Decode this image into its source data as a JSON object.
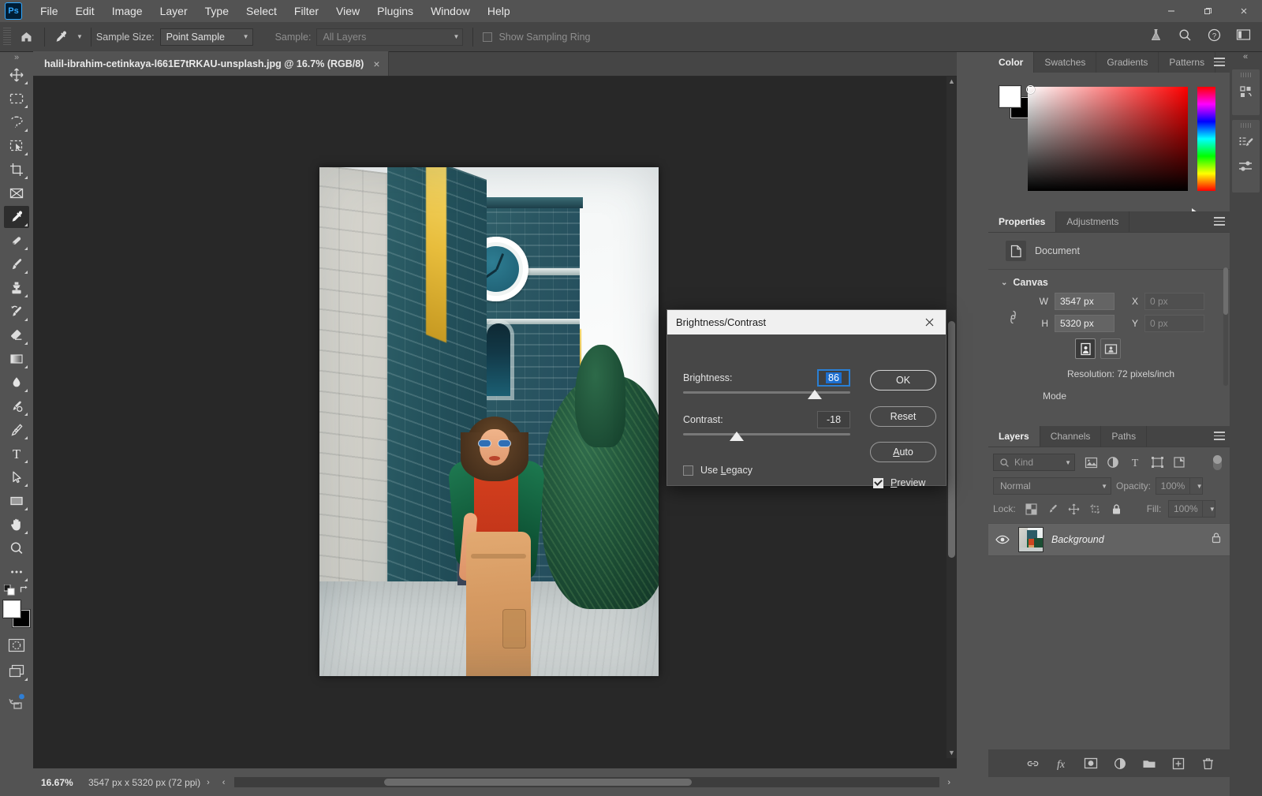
{
  "app": {
    "logo": "Ps",
    "menus": [
      "File",
      "Edit",
      "Image",
      "Layer",
      "Type",
      "Select",
      "Filter",
      "View",
      "Plugins",
      "Window",
      "Help"
    ],
    "window_controls": {
      "minimize": "minimize-icon",
      "restore": "restore-icon",
      "close": "close-icon"
    }
  },
  "options_bar": {
    "home_icon": "home-icon",
    "tool_icon": "eyedropper-icon",
    "sample_size_label": "Sample Size:",
    "sample_size_value": "Point Sample",
    "sample_label": "Sample:",
    "sample_value": "All Layers",
    "show_sampling_ring_label": "Show Sampling Ring",
    "show_sampling_ring_checked": false,
    "right_icons": [
      "flask-icon",
      "search-icon",
      "help-icon",
      "workspace-icon"
    ]
  },
  "toolbar": {
    "tools": [
      {
        "name": "move-tool",
        "icon": "move-icon",
        "has_flyout": true,
        "active": false
      },
      {
        "name": "marquee-tool",
        "icon": "rectangular-marquee-icon",
        "has_flyout": true,
        "active": false
      },
      {
        "name": "lasso-tool",
        "icon": "lasso-icon",
        "has_flyout": true,
        "active": false
      },
      {
        "name": "object-selection-tool",
        "icon": "object-selection-icon",
        "has_flyout": true,
        "active": false
      },
      {
        "name": "crop-tool",
        "icon": "crop-icon",
        "has_flyout": true,
        "active": false
      },
      {
        "name": "frame-tool",
        "icon": "frame-icon",
        "has_flyout": false,
        "active": false
      },
      {
        "name": "eyedropper-tool",
        "icon": "eyedropper-icon",
        "has_flyout": true,
        "active": true
      },
      {
        "name": "spot-healing-tool",
        "icon": "spot-healing-icon",
        "has_flyout": true,
        "active": false
      },
      {
        "name": "brush-tool",
        "icon": "brush-icon",
        "has_flyout": true,
        "active": false
      },
      {
        "name": "clone-stamp-tool",
        "icon": "clone-stamp-icon",
        "has_flyout": true,
        "active": false
      },
      {
        "name": "history-brush-tool",
        "icon": "history-brush-icon",
        "has_flyout": true,
        "active": false
      },
      {
        "name": "eraser-tool",
        "icon": "eraser-icon",
        "has_flyout": true,
        "active": false
      },
      {
        "name": "gradient-tool",
        "icon": "gradient-icon",
        "has_flyout": true,
        "active": false
      },
      {
        "name": "blur-tool",
        "icon": "blur-drop-icon",
        "has_flyout": true,
        "active": false
      },
      {
        "name": "dodge-tool",
        "icon": "dodge-icon",
        "has_flyout": true,
        "active": false
      },
      {
        "name": "pen-tool",
        "icon": "pen-icon",
        "has_flyout": true,
        "active": false
      },
      {
        "name": "type-tool",
        "icon": "type-t-icon",
        "has_flyout": true,
        "active": false
      },
      {
        "name": "path-selection-tool",
        "icon": "path-arrow-icon",
        "has_flyout": true,
        "active": false
      },
      {
        "name": "rectangle-tool",
        "icon": "rectangle-icon",
        "has_flyout": true,
        "active": false
      },
      {
        "name": "hand-tool",
        "icon": "hand-icon",
        "has_flyout": true,
        "active": false
      },
      {
        "name": "zoom-tool",
        "icon": "magnifier-icon",
        "has_flyout": false,
        "active": false
      },
      {
        "name": "edit-toolbar",
        "icon": "ellipsis-icon",
        "has_flyout": true,
        "active": false
      }
    ],
    "foreground_color": "#ffffff",
    "background_color": "#000000",
    "quick_mask_icon": "quick-mask-icon",
    "screen_mode_icon": "screen-mode-icon",
    "cloud_icon": "sync-cloud-icon"
  },
  "document": {
    "tab_title": "halil-ibrahim-cetinkaya-l661E7tRKAU-unsplash.jpg @ 16.7% (RGB/8)",
    "close_icon": "close-icon"
  },
  "status_bar": {
    "zoom": "16.67%",
    "dimensions": "3547 px x 5320 px (72 ppi)",
    "arrow": "›",
    "left_arrow": "‹"
  },
  "right_rail": {
    "collapse_icon": "collapse-chevrons-icon",
    "buttons": [
      "libraries-icon",
      "brush-settings-icon",
      "adjustments-sliders-icon"
    ]
  },
  "color_panel": {
    "tabs": [
      "Color",
      "Swatches",
      "Gradients",
      "Patterns"
    ],
    "active_tab": "Color",
    "menu_icon": "panel-menu-icon",
    "foreground": "#ffffff",
    "background": "#000000"
  },
  "properties_panel": {
    "tabs": [
      "Properties",
      "Adjustments"
    ],
    "active_tab": "Properties",
    "menu_icon": "panel-menu-icon",
    "doc_icon": "document-icon",
    "doc_label": "Document",
    "section_title": "Canvas",
    "twisty": "⌄",
    "link_icon": "link-chain-icon",
    "fields": [
      {
        "key": "W",
        "value": "3547 px",
        "empty": false
      },
      {
        "key": "X",
        "value": "0 px",
        "empty": true
      },
      {
        "key": "H",
        "value": "5320 px",
        "empty": false
      },
      {
        "key": "Y",
        "value": "0 px",
        "empty": true
      }
    ],
    "orientation": [
      {
        "name": "portrait-orientation",
        "icon": "portrait-icon",
        "active": true
      },
      {
        "name": "landscape-orientation",
        "icon": "landscape-icon",
        "active": false
      }
    ],
    "resolution": "Resolution: 72 pixels/inch",
    "mode_label": "Mode"
  },
  "layers_panel": {
    "tabs": [
      "Layers",
      "Channels",
      "Paths"
    ],
    "active_tab": "Layers",
    "menu_icon": "panel-menu-icon",
    "filter_icon": "search-icon",
    "filter_value": "Kind",
    "filter_type_icons": [
      "pixel-layer-filter-icon",
      "adjustment-layer-filter-icon",
      "type-layer-filter-icon",
      "shape-layer-filter-icon",
      "smart-object-filter-icon"
    ],
    "filter_toggle_icon": "filter-toggle-icon",
    "blend_mode": "Normal",
    "opacity_label": "Opacity:",
    "opacity_value": "100%",
    "lock_label": "Lock:",
    "lock_icons": [
      "lock-transparency-icon",
      "lock-image-icon",
      "lock-position-icon",
      "lock-artboard-icon",
      "lock-all-icon"
    ],
    "fill_label": "Fill:",
    "fill_value": "100%",
    "layers": [
      {
        "name": "Background",
        "visible": true,
        "locked": true,
        "eye_icon": "eye-icon",
        "lock_icon": "lock-icon"
      }
    ],
    "bottom_icons": [
      "link-layers-icon",
      "layer-style-fx-icon",
      "layer-mask-icon",
      "adjustment-layer-icon",
      "new-group-icon",
      "new-layer-icon",
      "delete-layer-icon"
    ],
    "fx_label": "fx"
  },
  "dialog": {
    "title": "Brightness/Contrast",
    "close_icon": "close-icon",
    "brightness_label": "Brightness:",
    "brightness_value": "86",
    "contrast_label": "Contrast:",
    "contrast_value": "-18",
    "use_legacy_label": "Use Legacy",
    "use_legacy_checked": false,
    "preview_label": "Preview",
    "preview_checked": true,
    "buttons": [
      {
        "name": "ok-button",
        "label": "OK",
        "primary": true
      },
      {
        "name": "reset-button",
        "label": "Reset",
        "primary": false
      },
      {
        "name": "auto-button",
        "label": "Auto",
        "primary": false
      }
    ],
    "brightness_slider_percent": 80,
    "contrast_slider_percent": 32
  }
}
